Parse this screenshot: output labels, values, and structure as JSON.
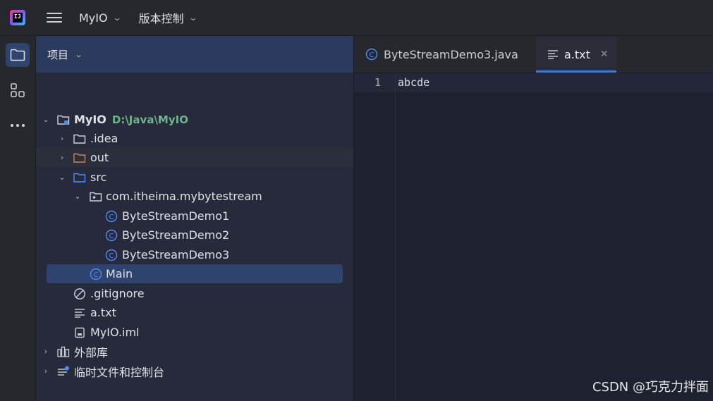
{
  "titlebar": {
    "logo_text": "IJ",
    "project_menu": "MyIO",
    "vcs_menu": "版本控制"
  },
  "panel": {
    "title": "项目"
  },
  "tree": {
    "root_name": "MyIO",
    "root_path": "D:\\Java\\MyIO",
    "idea": ".idea",
    "out": "out",
    "src": "src",
    "package": "com.itheima.mybytestream",
    "demo1": "ByteStreamDemo1",
    "demo2": "ByteStreamDemo2",
    "demo3": "ByteStreamDemo3",
    "main": "Main",
    "gitignore": ".gitignore",
    "atxt": "a.txt",
    "iml": "MyIO.iml",
    "external_libs": "外部库",
    "scratches": "临时文件和控制台"
  },
  "tabs": {
    "tab1": "ByteStreamDemo3.java",
    "tab2": "a.txt"
  },
  "editor": {
    "line_number": "1",
    "line_text": "abcde"
  },
  "watermark": "CSDN @巧克力拌面",
  "colors": {
    "accent": "#3d7bd6",
    "selection": "#2e436e",
    "class_icon": "#4f8cff",
    "folder_out": "#c8864b",
    "folder_src": "#4f8cff",
    "path_text": "#6fb58a"
  }
}
